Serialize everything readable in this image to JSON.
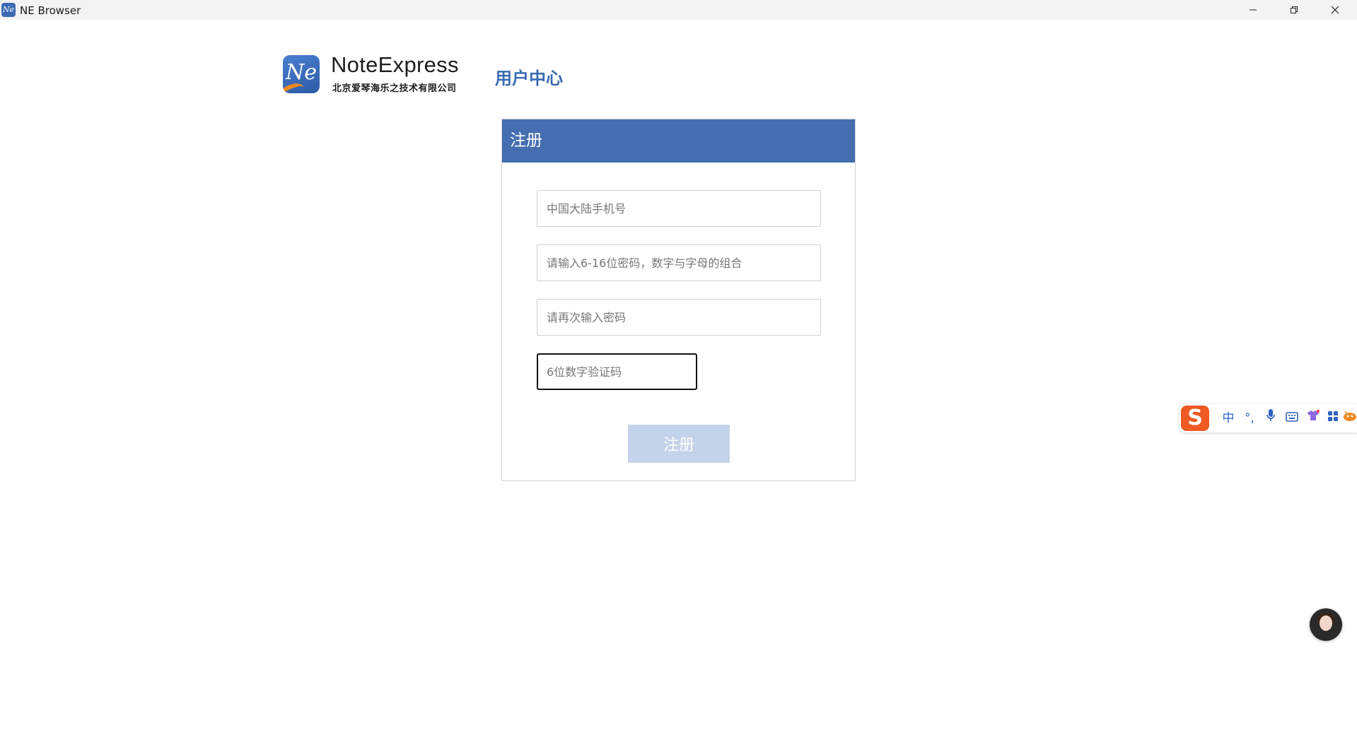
{
  "window": {
    "title": "NE Browser",
    "app_icon_text": "Ne"
  },
  "header": {
    "logo_mark_text": "Ne",
    "logo_name": "NoteExpress",
    "logo_company": "北京爱琴海乐之技术有限公司",
    "user_center": "用户中心"
  },
  "form": {
    "title": "注册",
    "phone_placeholder": "中国大陆手机号",
    "password_placeholder": "请输入6-16位密码，数字与字母的组合",
    "confirm_placeholder": "请再次输入密码",
    "code_placeholder": "6位数字验证码",
    "submit_label": "注册"
  },
  "ime_toolbar": {
    "logo": "S",
    "mode": "中",
    "punct": "°,",
    "icons": [
      "microphone-icon",
      "keyboard-icon",
      "skin-icon",
      "toolbox-icon",
      "mascot-icon"
    ]
  },
  "colors": {
    "brand_blue": "#456eb0",
    "disabled_button": "#c5d3ea",
    "ime_orange": "#ee5a24"
  }
}
